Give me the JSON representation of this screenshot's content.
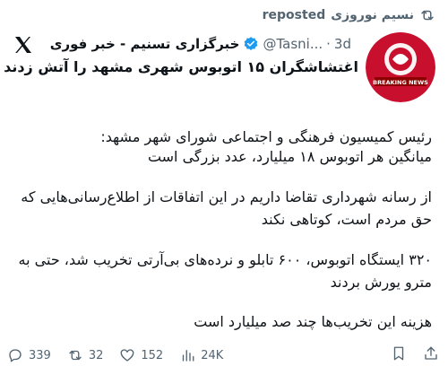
{
  "repost": {
    "user": "نسیم نوروزی",
    "label": "reposted"
  },
  "author": {
    "name": "خبرگزاری تسنیم - خبر فوری",
    "handle": "@Tasni...",
    "separator": "·",
    "time": "3d",
    "avatar_text": "BREAKING NEWS"
  },
  "tweet": {
    "title": "اغتشاشگران ۱۵ اتوبوس شهری مشهد را آتش زدند",
    "paragraphs": [
      "رئیس کمیسیون فرهنگی و اجتماعی شورای شهر مشهد:",
      "میانگین هر اتوبوس ۱۸ میلیارد، عدد بزرگی است",
      "از رسانه شهرداری تقاضا داریم در این اتفاقات از اطلاع‌رسانی‌هایی که حق مردم است، کوتاهی نکند",
      "۳۲۰ ایستگاه اتوبوس، ۶۰۰ تابلو و نرده‌های بی‌آرتی تخریب شد، حتی به مترو یورش بردند",
      "هزینه این تخریب‌ها چند صد میلیارد است"
    ]
  },
  "actions": {
    "replies": "339",
    "reposts": "32",
    "likes": "152",
    "views": "24K"
  },
  "colors": {
    "text": "#0f1419",
    "muted": "#536471",
    "verified": "#1d9bf0",
    "avatar_red": "#c8102e"
  }
}
